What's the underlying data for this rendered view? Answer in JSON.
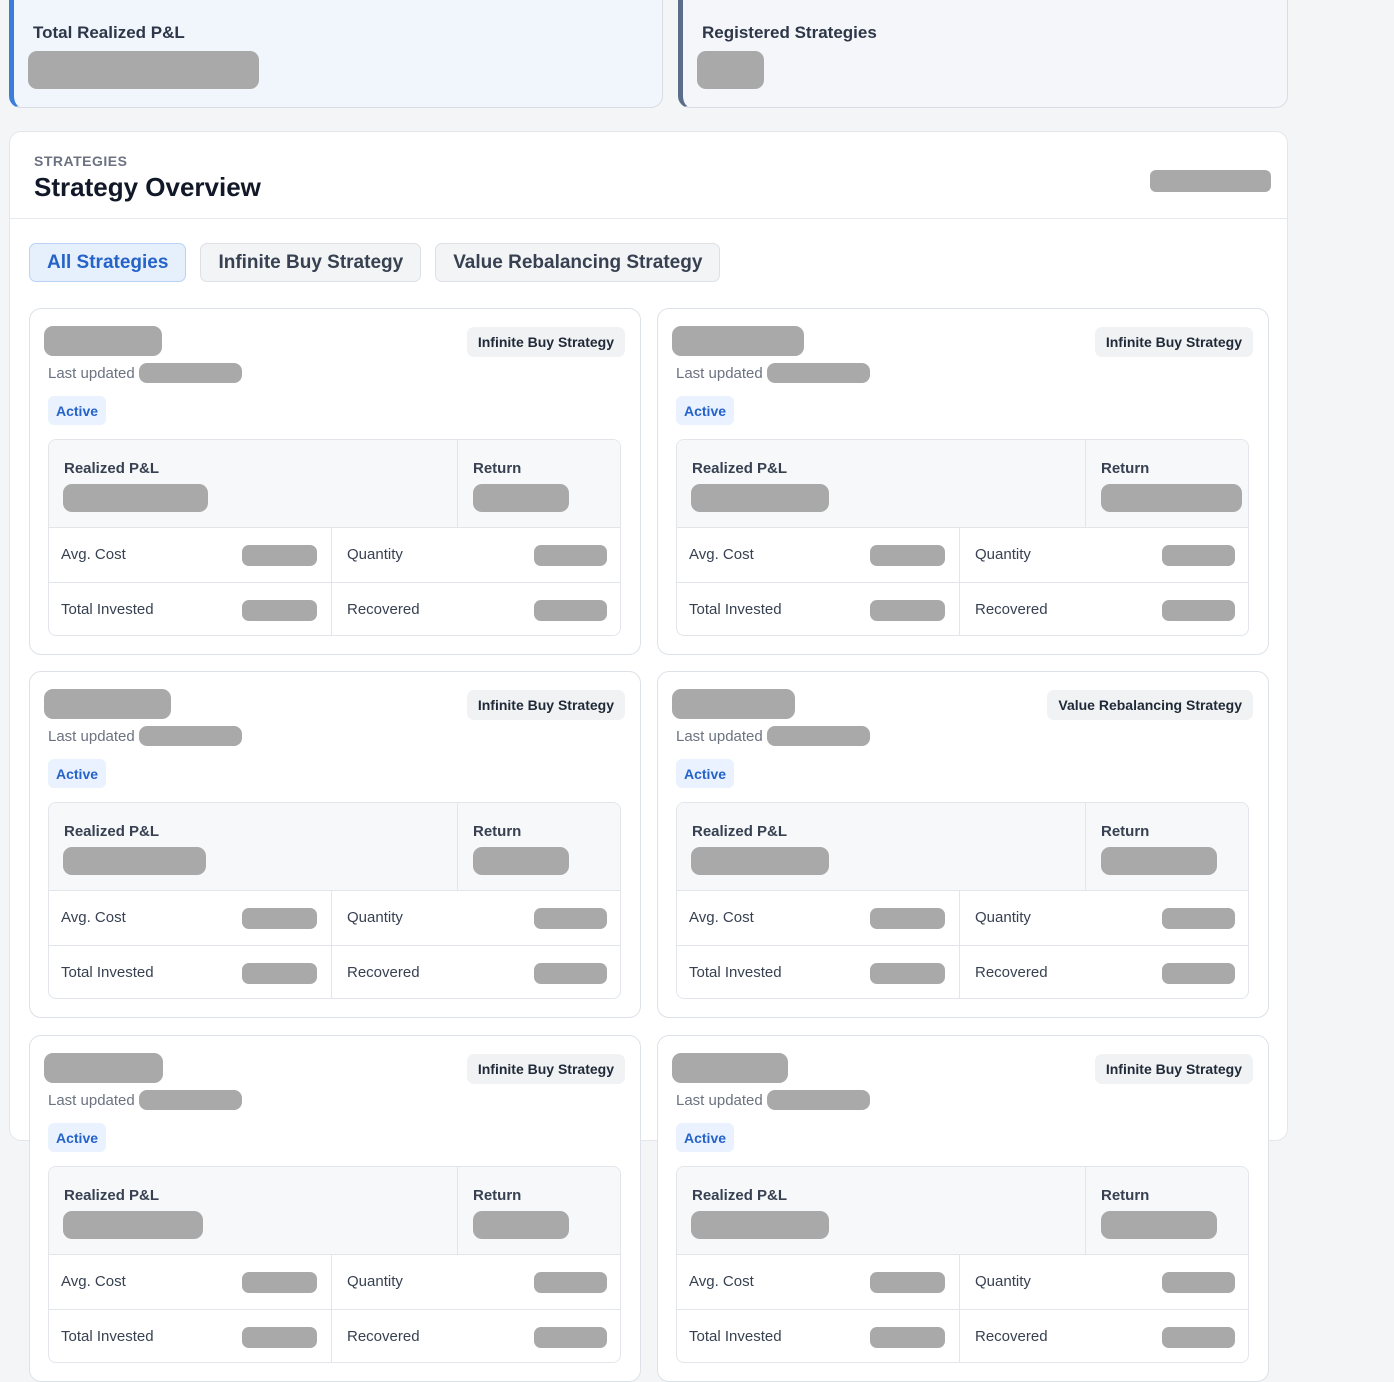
{
  "summary": {
    "realized_pnl_label": "Total Realized P&L",
    "registered_label": "Registered Strategies"
  },
  "panel": {
    "eyebrow": "STRATEGIES",
    "title": "Strategy Overview"
  },
  "tabs": [
    {
      "label": "All Strategies",
      "active": true
    },
    {
      "label": "Infinite Buy Strategy",
      "active": false
    },
    {
      "label": "Value Rebalancing Strategy",
      "active": false
    }
  ],
  "cards": [
    {
      "type": "Infinite Buy Strategy",
      "status": "Active"
    },
    {
      "type": "Infinite Buy Strategy",
      "status": "Active"
    },
    {
      "type": "Infinite Buy Strategy",
      "status": "Active"
    },
    {
      "type": "Value Rebalancing Strategy",
      "status": "Active"
    },
    {
      "type": "Infinite Buy Strategy",
      "status": "Active"
    },
    {
      "type": "Infinite Buy Strategy",
      "status": "Active"
    }
  ],
  "card_labels": {
    "last_updated": "Last updated",
    "realized_pnl": "Realized P&L",
    "return": "Return",
    "avg_cost": "Avg. Cost",
    "quantity": "Quantity",
    "total_invested": "Total Invested",
    "recovered": "Recovered"
  },
  "colors": {
    "accent_blue": "#2563c9",
    "pnl_border": "#3b7ddd",
    "registered_border": "#5a6d8a",
    "redacted": "#a9a9a9"
  }
}
